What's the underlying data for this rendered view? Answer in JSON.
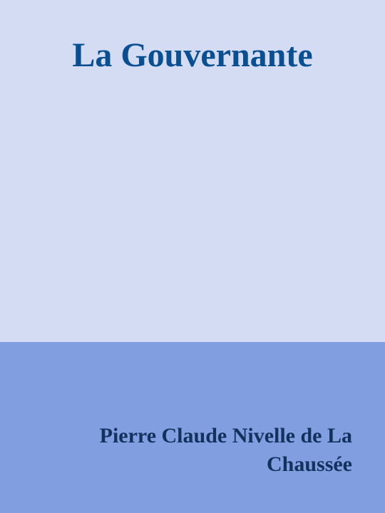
{
  "book": {
    "title": "La Gouvernante",
    "author": "Pierre Claude Nivelle de La Chaussée"
  },
  "colors": {
    "top_background": "#d3dcf3",
    "bottom_background": "#819ee1",
    "title_color": "#0a4f92",
    "author_color": "#12325d"
  }
}
